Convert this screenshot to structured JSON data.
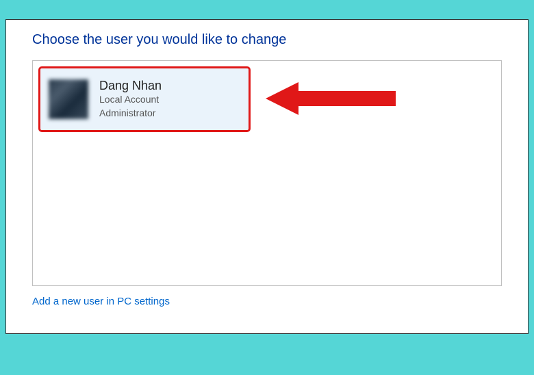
{
  "page": {
    "title": "Choose the user you would like to change"
  },
  "user": {
    "name": "Dang Nhan",
    "account_type": "Local Account",
    "role": "Administrator"
  },
  "link": {
    "add_user": "Add a new user in PC settings"
  },
  "colors": {
    "highlight_border": "#e01818",
    "background_band": "#55d6d6"
  }
}
